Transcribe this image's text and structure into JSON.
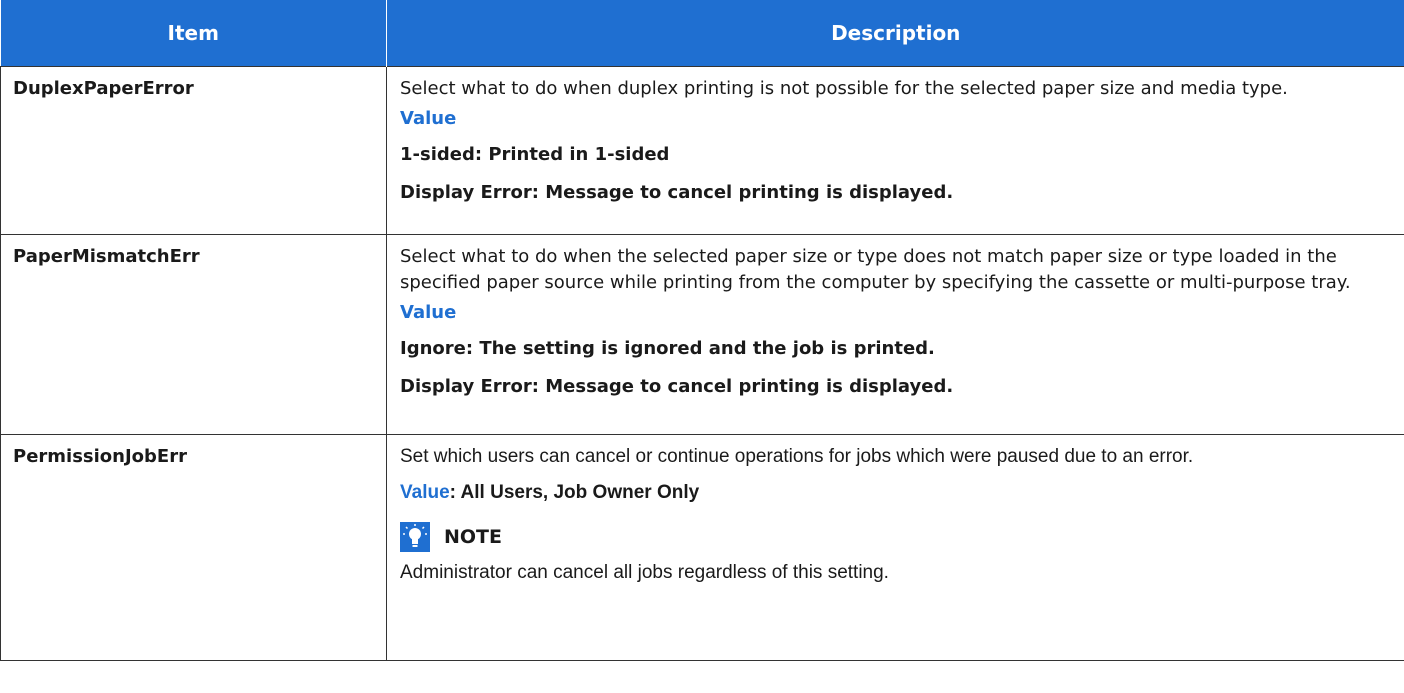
{
  "header": {
    "item": "Item",
    "description": "Description"
  },
  "rows": [
    {
      "item": "DuplexPaperError",
      "description": "Select what to do when duplex printing is not possible for the selected paper size and media type.",
      "value_label": "Value",
      "options": [
        "1-sided: Printed in 1-sided",
        "Display Error: Message to cancel printing is displayed."
      ]
    },
    {
      "item": "PaperMismatchErr",
      "description": "Select what to do when the selected paper size or type does not match paper size or type loaded in the specified paper source while printing from the computer by specifying the cassette or multi-purpose tray.",
      "value_label": "Value",
      "options": [
        "Ignore: The setting is ignored and the job is printed.",
        "Display Error: Message to cancel printing is displayed."
      ]
    },
    {
      "item": "PermissionJobErr",
      "description": "Set which users can cancel or continue operations for jobs which were paused due to an error.",
      "value_label": "Value",
      "value_text": ": All Users, Job Owner Only",
      "note_title": "NOTE",
      "note_text": "Administrator can cancel all jobs regardless of this setting."
    }
  ],
  "colors": {
    "accent": "#1f6fd1",
    "border": "#333333"
  },
  "icons": {
    "note": "note-lightbulb-icon"
  }
}
